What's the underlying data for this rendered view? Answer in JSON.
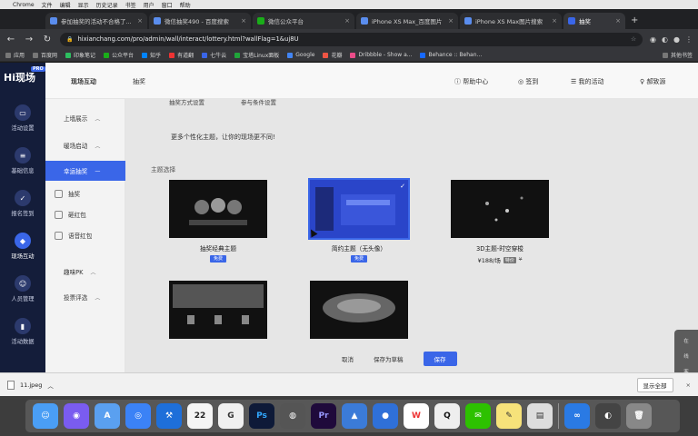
{
  "menubar": {
    "items": [
      "",
      "Chrome",
      "文件",
      "编辑",
      "显示",
      "历史记录",
      "书签",
      "用户",
      "窗口",
      "帮助"
    ]
  },
  "browser": {
    "tabs": [
      {
        "title": "参加抽奖的活动不合格了..."
      },
      {
        "title": "微信抽奖490 - 百度搜索"
      },
      {
        "title": "微信公众平台"
      },
      {
        "title": "iPhone XS Max_百度图片"
      },
      {
        "title": "iPhone XS Max图片搜索"
      },
      {
        "title": "抽奖",
        "active": true
      }
    ],
    "url": "hixianchang.com/pro/admin/wall/interact/lottery.html?wallFlag=1&uj8U",
    "bookmarks": [
      "应用",
      "百度网",
      "印象笔记",
      "公众平台",
      "知乎",
      "有道翻",
      "七牛云",
      "宝塔Linux面板",
      "Google",
      "花瓣",
      "Dribbble - Show a...",
      "Behance :: Behan..."
    ],
    "bookmark_other": "其他书签"
  },
  "app": {
    "logo": "Hi现场",
    "logo_badge": "PRO",
    "leftnav": [
      {
        "label": "活动设置",
        "icon": "screen-icon"
      },
      {
        "label": "基础信息",
        "icon": "doc-icon"
      },
      {
        "label": "报名签到",
        "icon": "clipboard-icon"
      },
      {
        "label": "现场互动",
        "icon": "interaction-icon",
        "active": true
      },
      {
        "label": "人员管理",
        "icon": "user-icon"
      },
      {
        "label": "活动数据",
        "icon": "chart-icon"
      }
    ],
    "header": {
      "title": "现场互动",
      "crumb": "抽奖",
      "help": "帮助中心",
      "signin": "签到",
      "my_activity": "我的活动",
      "user": "郝致源"
    },
    "submenu": {
      "items": [
        "上墙展示",
        "暖场启动",
        "幸运抽奖"
      ],
      "sub_items": [
        "抽奖",
        "砸红包",
        "语音红包"
      ],
      "more": [
        "趣味PK",
        "投票评选"
      ]
    },
    "main": {
      "stub": [
        "抽奖方式设置",
        "参与条件设置"
      ],
      "description": "更多个性化主题，让你的现场更不同!",
      "section_label": "主题选择",
      "themes": [
        {
          "name": "抽奖经典主题",
          "badge": "免费",
          "selected": false
        },
        {
          "name": "简约主题（无头像）",
          "badge": "免费",
          "selected": true
        },
        {
          "name": "3D主题-时空穿梭",
          "price": "¥188/场",
          "price_badge": "特价",
          "old_price": "¥"
        },
        {
          "name": "",
          "badge": ""
        },
        {
          "name": "",
          "badge": ""
        }
      ],
      "buttons": {
        "cancel": "取消",
        "save_template": "保存为草稿",
        "save": "保存"
      }
    },
    "float_tools": [
      "在",
      "线",
      "客",
      "服"
    ]
  },
  "downloads": {
    "file": "11.jpeg",
    "show_all": "显示全部"
  },
  "dock": [
    "finder",
    "siri",
    "launchpad",
    "safari",
    "xcode",
    "calendar",
    "cleaner",
    "photoshop",
    "aperture",
    "premiere",
    "keynote",
    "unknown",
    "wps",
    "qq",
    "wechat",
    "notes",
    "preview",
    "baidu-netdisk",
    "chrome",
    "trash"
  ]
}
